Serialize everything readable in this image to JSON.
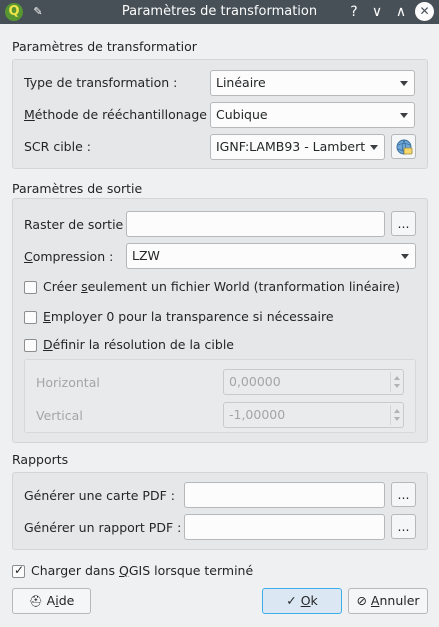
{
  "window": {
    "title": "Paramètres de transformation",
    "help_glyph": "?",
    "minimize_glyph": "∨",
    "maximize_glyph": "∧",
    "close_glyph": "✕",
    "logo_letter": "Q",
    "pin_glyph": "📌"
  },
  "transform_group": {
    "title": "Paramètres de transformatior",
    "type_label": "Type de transformation :",
    "type_value": "Linéaire",
    "resampling_label_pre": "",
    "resampling_label_key": "M",
    "resampling_label_post": "éthode de rééchantillonage",
    "resampling_value": "Cubique",
    "crs_label": "SCR cible :",
    "crs_value": "IGNF:LAMB93 - Lambert"
  },
  "output_group": {
    "title": "Paramètres de sortie",
    "raster_label": "Raster de sortie",
    "raster_value": "",
    "browse_label": "...",
    "compression_label_key": "C",
    "compression_label_post": "ompression :",
    "compression_value": "LZW",
    "world_file_pre": "Créer ",
    "world_file_key": "s",
    "world_file_post": "eulement un fichier World (tranformation linéaire)",
    "world_file_checked": false,
    "transparency_key": "E",
    "transparency_post": "mployer 0 pour la transparence si nécessaire",
    "transparency_checked": false,
    "resolution_key": "D",
    "resolution_post": "éfinir la résolution de la cible",
    "resolution_checked": false,
    "horizontal_label": "Horizontal",
    "horizontal_value": "0,00000",
    "vertical_label": "Vertical",
    "vertical_value": "-1,00000"
  },
  "reports_group": {
    "title": "Rapports",
    "pdf_map_label": "Générer une carte PDF :",
    "pdf_map_value": "",
    "pdf_report_label": "Générer un rapport PDF :",
    "pdf_report_value": "",
    "browse_label": "..."
  },
  "load_in_qgis": {
    "label_pre": "Charger dans ",
    "label_key": "Q",
    "label_post": "GIS lorsque terminé",
    "checked": true
  },
  "buttons": {
    "help_pre": "A",
    "help_key": "i",
    "help_post": "de",
    "ok_pre": "",
    "ok_key": "O",
    "ok_post": "k",
    "cancel_pre": "",
    "cancel_key": "A",
    "cancel_post": "nnuler",
    "ok_icon_glyph": "✓",
    "cancel_icon_glyph": "⊘",
    "help_icon_glyph": "⛑"
  }
}
